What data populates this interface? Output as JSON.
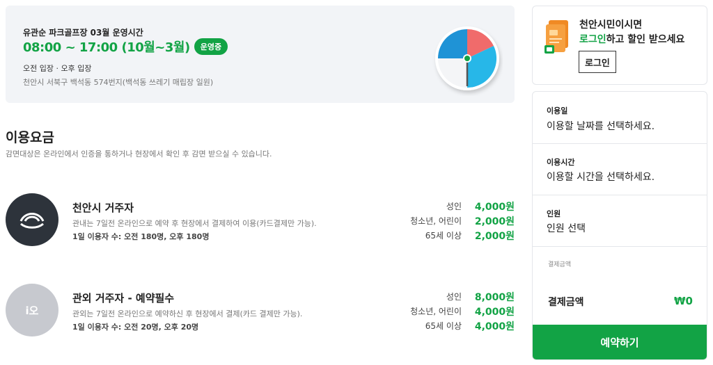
{
  "hours": {
    "title": "유관순 파크골프장 03월 운영시간",
    "time": "08:00 ~ 17:00 (10월~3월)",
    "status": "운영중",
    "entry": "오전 입장 · 오후 입장",
    "address": "천안시 서북구 백석동 574번지(백석동 쓰레기 매립장 일원)"
  },
  "fees": {
    "title": "이용요금",
    "description": "감면대상은 온라인에서 인증을 통하거나 현장에서 확인 후 감면 받으실 수 있습니다.",
    "groups": [
      {
        "name": "천안시 거주자",
        "note": "관내는 7일전 온라인으로 예약 후 현장에서 결제하여 이용(카드결제만 가능).",
        "capacity": "1일 이용자 수: 오전 180명, 오후 180명",
        "avatar_icon": "cheonan-logo-icon",
        "prices": [
          {
            "label": "성인",
            "value": "4,000원"
          },
          {
            "label": "청소년, 어린이",
            "value": "2,000원"
          },
          {
            "label": "65세 이상",
            "value": "2,000원"
          }
        ]
      },
      {
        "name": "관외 거주자 - 예약필수",
        "note": "관외는 7일전 온라인으로 예약하신 후 현장에서 결제(카드 결제만 가능).",
        "capacity": "1일 이용자 수: 오전 20명, 오후 20명",
        "avatar_glyph": "i오",
        "prices": [
          {
            "label": "성인",
            "value": "8,000원"
          },
          {
            "label": "청소년, 어린이",
            "value": "4,000원"
          },
          {
            "label": "65세 이상",
            "value": "4,000원"
          }
        ]
      }
    ]
  },
  "login_card": {
    "line1": "천안시민이시면",
    "line2_accent": "로그인",
    "line2_rest": "하고 할인 받으세요",
    "button": "로그인"
  },
  "booking": {
    "date_label": "이용일",
    "date_value": "이용할 날짜를 선택하세요.",
    "time_label": "이용시간",
    "time_value": "이용할 시간을 선택하세요.",
    "people_label": "인원",
    "people_value": "인원 선택",
    "payment_small": "결제금액",
    "payment_label": "결제금액",
    "payment_amount": "₩0",
    "reserve_button": "예약하기"
  },
  "colors": {
    "accent": "#12a345",
    "card_bg": "#f2f4f7",
    "dark_avatar": "#2d333b",
    "light_avatar": "#c7c9cf"
  }
}
